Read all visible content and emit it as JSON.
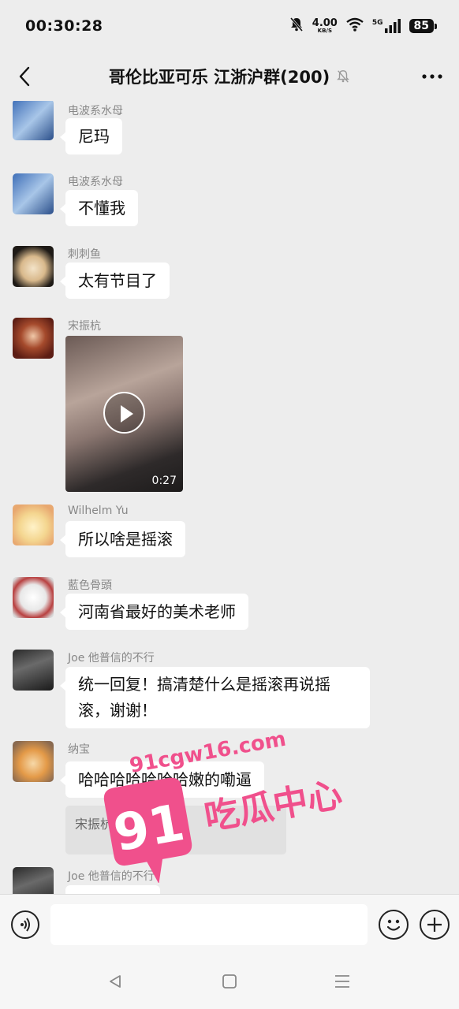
{
  "status_bar": {
    "time": "00:30:28",
    "net_speed": "4.00",
    "net_speed_unit": "KB/S",
    "network_type": "5G",
    "battery": "85",
    "icons": [
      "mute-bell-icon",
      "wifi-icon",
      "signal-icon",
      "battery-icon"
    ]
  },
  "header": {
    "title": "哥伦比亚可乐 江浙沪群(200)",
    "back_icon": "chevron-left-icon",
    "muted_icon": "mute-bell-icon",
    "more_icon": "more-dots-icon"
  },
  "messages": [
    {
      "sender": "电波系水母",
      "text": "尼玛"
    },
    {
      "sender": "电波系水母",
      "text": "不懂我"
    },
    {
      "sender": "刺刺鱼",
      "text": "太有节目了"
    },
    {
      "sender": "宋振杭",
      "video_duration": "0:27"
    },
    {
      "sender": "Wilhelm Yu",
      "text": "所以啥是摇滚"
    },
    {
      "sender": "藍色骨頭",
      "text": "河南省最好的美术老师"
    },
    {
      "sender": "Joe 他普信的不行",
      "text": "统一回复！搞清楚什么是摇滚再说摇滚，谢谢！"
    },
    {
      "sender": "纳宝",
      "text": "哈哈哈哈哈哈哈嫩的嘞逼",
      "quote": "宋振杭："
    },
    {
      "sender": "Joe 他普信的不行"
    }
  ],
  "watermark": {
    "url": "91cgw16.com",
    "logo": "91",
    "text": "吃瓜中心",
    "color": "#f0508c"
  },
  "input_bar": {
    "value": "",
    "voice_icon": "voice-icon",
    "emoji_icon": "emoji-icon",
    "plus_icon": "plus-icon"
  },
  "nav_bar": {
    "icons": [
      "back-triangle-icon",
      "home-square-icon",
      "menu-lines-icon"
    ]
  }
}
